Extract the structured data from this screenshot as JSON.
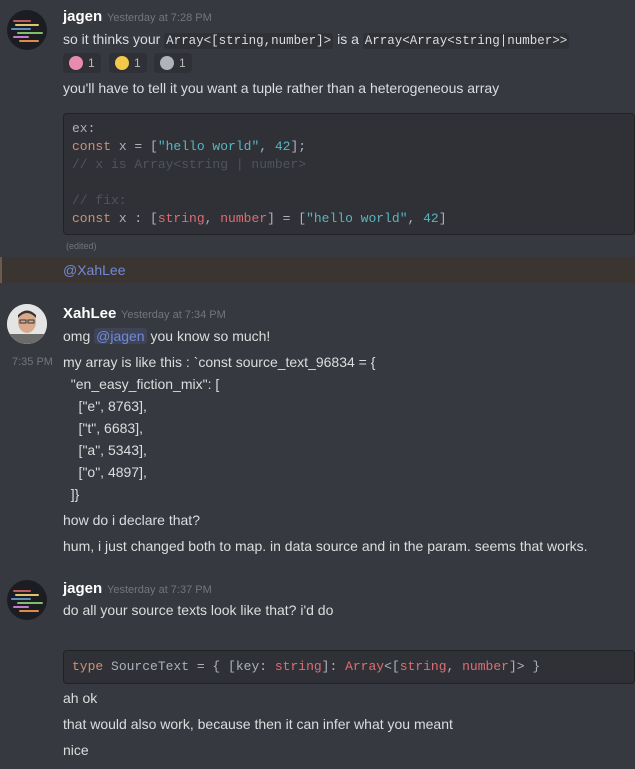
{
  "messages": {
    "m1": {
      "username": "jagen",
      "timestamp": "Yesterday at 7:28 PM",
      "line1_pre": "so it thinks your ",
      "line1_code1": "Array<[string,number]>",
      "line1_mid": " is a ",
      "line1_code2": "Array<Array<string|number>>",
      "reactions": [
        {
          "icon": "brain-emoji-icon",
          "count": "1",
          "color": "#e98bb0"
        },
        {
          "icon": "exploding-emoji-icon",
          "count": "1",
          "color": "#f2c94c"
        },
        {
          "icon": "helmet-emoji-icon",
          "count": "1",
          "color": "#b0b4ba"
        }
      ],
      "line2": "you'll have to tell it you want a tuple rather than a heterogeneous array",
      "code": {
        "l1": "ex:",
        "l2_a": "const",
        "l2_b": " x = [",
        "l2_c": "\"hello world\"",
        "l2_d": ", ",
        "l2_e": "42",
        "l2_f": "];",
        "l3": "// x is Array<string | number>",
        "l5": "// fix:",
        "l6_a": "const",
        "l6_b": " x : [",
        "l6_c": "string",
        "l6_d": ", ",
        "l6_e": "number",
        "l6_f": "] = [",
        "l6_g": "\"hello world\"",
        "l6_h": ", ",
        "l6_i": "42",
        "l6_j": "]"
      },
      "edited": "(edited)",
      "mention_line": "@XahLee"
    },
    "m2": {
      "username": "XahLee",
      "timestamp": "Yesterday at 7:34 PM",
      "line1_pre": "omg ",
      "line1_mention": "@jagen",
      "line1_post": " you know so much!",
      "hover_time": "7:35 PM",
      "lines": [
        "my array is like this : `const source_text_96834 = {",
        "  \"en_easy_fiction_mix\": [",
        "    [\"e\", 8763],",
        "    [\"t\", 6683],",
        "    [\"a\", 5343],",
        "    [\"o\", 4897],",
        "  ]}"
      ],
      "line_q": "how do i declare that?",
      "line_r": "hum, i just changed both to map. in data source and in the param. seems that works."
    },
    "m3": {
      "username": "jagen",
      "timestamp": "Yesterday at 7:37 PM",
      "line1": "do all your source texts look like that? i'd do",
      "code": {
        "a": "type",
        "b": " SourceText = { [key: ",
        "c": "string",
        "d": "]: ",
        "e": "Array",
        "f": "<[",
        "g": "string",
        "h": ", ",
        "i": "number",
        "j": "]> }"
      },
      "lines": [
        "ah ok",
        "that would also work, because then it can infer what you meant",
        "nice"
      ]
    }
  }
}
